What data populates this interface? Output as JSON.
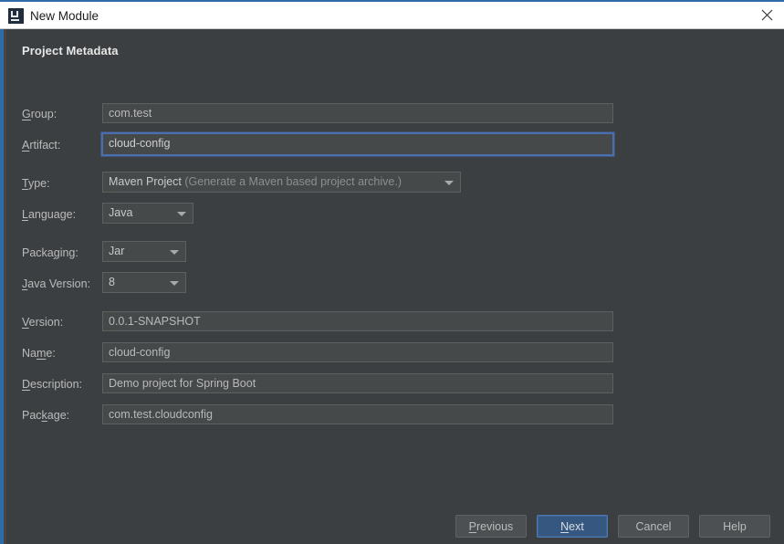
{
  "window": {
    "title": "New Module",
    "app_icon": "intellij-idea-icon",
    "close_icon": "close-icon",
    "accent_color": "#2d6ca8",
    "background_color": "#3c3f41"
  },
  "dialog": {
    "section_title": "Project Metadata",
    "fields": [
      {
        "id": "group",
        "label": "Group:",
        "mnemonic": "G",
        "type": "text",
        "value": "com.test",
        "focused": false
      },
      {
        "id": "artifact",
        "label": "Artifact:",
        "mnemonic": "A",
        "type": "text",
        "value": "cloud-config",
        "focused": true
      },
      {
        "id": "type",
        "label": "Type:",
        "mnemonic": "T",
        "type": "combo",
        "value": "Maven Project",
        "value_note": " (Generate a Maven based project archive.)",
        "focused": false
      },
      {
        "id": "language",
        "label": "Language:",
        "mnemonic": "L",
        "type": "combo",
        "value": "Java",
        "focused": false
      },
      {
        "id": "packaging",
        "label": "Packaging:",
        "mnemonic": "g",
        "type": "combo",
        "value": "Jar",
        "focused": false
      },
      {
        "id": "java-version",
        "label": "Java Version:",
        "mnemonic": "J",
        "type": "combo",
        "value": "8",
        "focused": false
      },
      {
        "id": "version",
        "label": "Version:",
        "mnemonic": "V",
        "type": "text",
        "value": "0.0.1-SNAPSHOT",
        "focused": false
      },
      {
        "id": "name",
        "label": "Name:",
        "mnemonic": "m",
        "type": "text",
        "value": "cloud-config",
        "focused": false
      },
      {
        "id": "description",
        "label": "Description:",
        "mnemonic": "D",
        "type": "text",
        "value": "Demo project for Spring Boot",
        "focused": false
      },
      {
        "id": "package",
        "label": "Package:",
        "mnemonic": "k",
        "type": "text",
        "value": "com.test.cloudconfig",
        "focused": false
      }
    ],
    "buttons": [
      {
        "id": "previous",
        "label": "Previous",
        "mnemonic": "P",
        "default": false
      },
      {
        "id": "next",
        "label": "Next",
        "mnemonic": "N",
        "default": true
      },
      {
        "id": "cancel",
        "label": "Cancel",
        "mnemonic": "",
        "default": false
      },
      {
        "id": "help",
        "label": "Help",
        "mnemonic": "",
        "default": false
      }
    ]
  }
}
